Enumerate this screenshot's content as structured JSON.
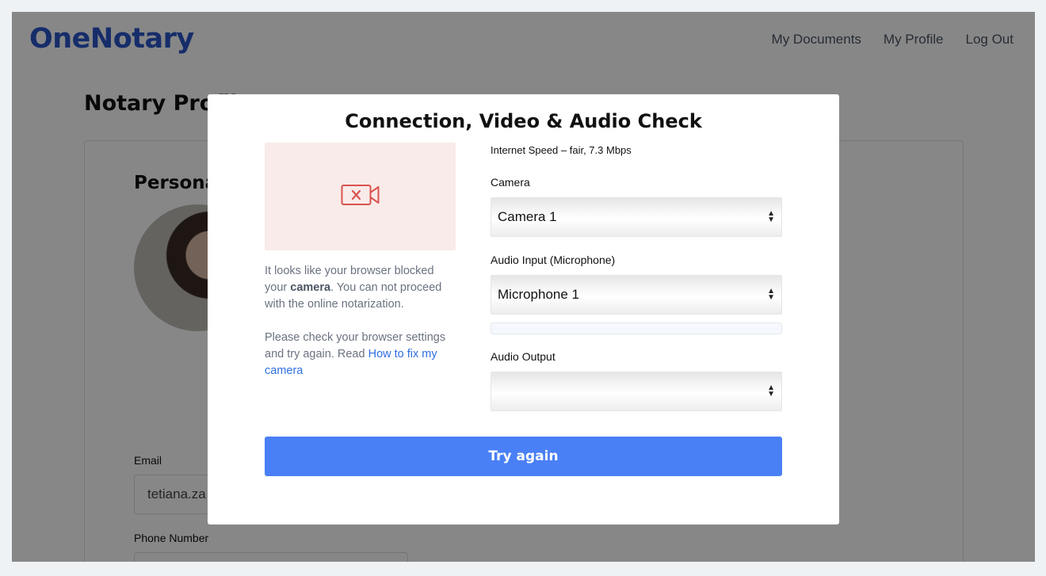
{
  "header": {
    "logo": "OneNotary",
    "nav": [
      "My Documents",
      "My Profile",
      "Log Out"
    ]
  },
  "background_page": {
    "title": "Notary Profile",
    "section_title": "Personal",
    "email_label": "Email",
    "email_value": "tetiana.za",
    "phone_label": "Phone Number"
  },
  "modal": {
    "title": "Connection, Video & Audio Check",
    "camera_blocked_icon": "camera-off-icon",
    "blocked_prefix": "It looks like your browser blocked your ",
    "blocked_bold": "camera",
    "blocked_suffix": ". You can not proceed with the online notarization.",
    "help_prefix": "Please check your browser settings and try again. Read ",
    "help_link": "How to fix my camera",
    "internet_speed": "Internet Speed – fair, 7.3 Mbps",
    "camera_label": "Camera",
    "camera_value": "Camera 1",
    "audio_input_label": "Audio Input (Microphone)",
    "audio_input_value": "Microphone 1",
    "audio_output_label": "Audio Output",
    "audio_output_value": "",
    "try_again_label": "Try again"
  },
  "colors": {
    "brand": "#2b56c8",
    "primary_button": "#4a80f5",
    "link": "#2f6ee0",
    "camera_icon": "#d9534f"
  }
}
